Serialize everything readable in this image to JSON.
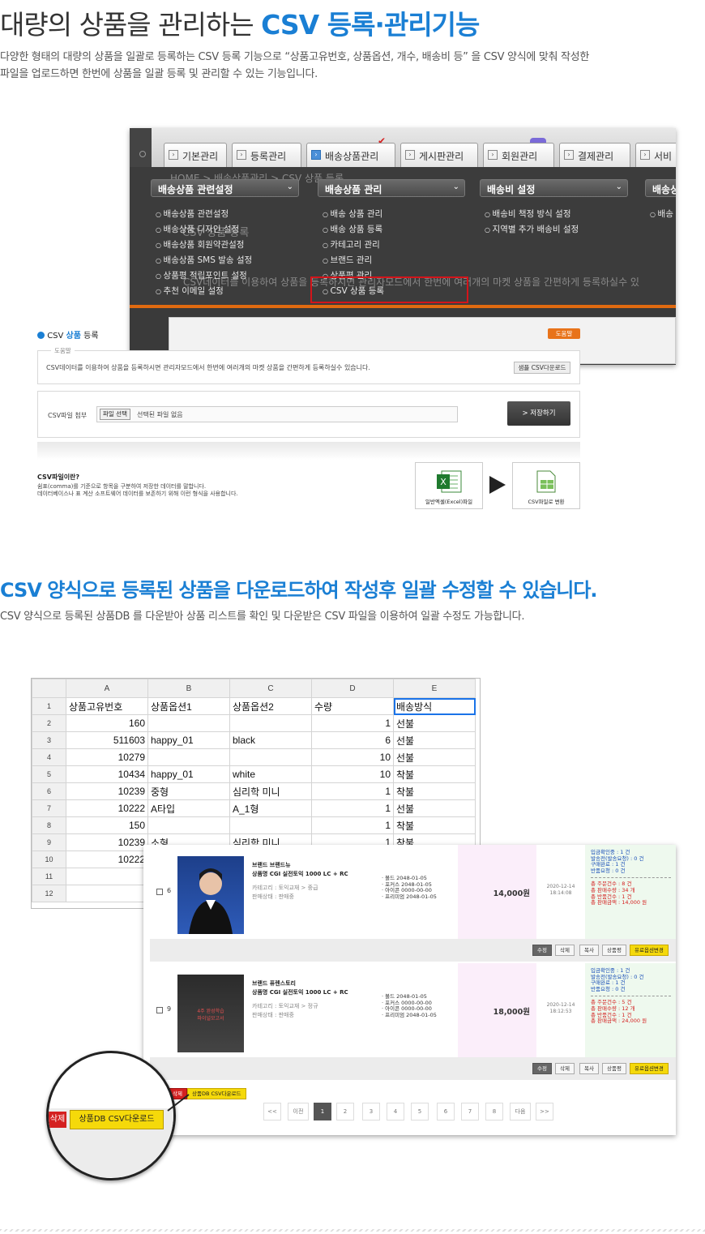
{
  "section1": {
    "title_plain": "대량의 상품을 관리하는 ",
    "title_highlight": "CSV 등록·관리기능",
    "desc_line1": "다양한 형태의 대량의 상품을 일괄로 등록하는 CSV 등록 기능으로 “상품고유번호, 상품옵션, 개수, 배송비 등” 을 CSV 양식에 맞춰 작성한",
    "desc_line2": "파일을 업로드하면 한번에 상품을 일괄 등록 및 관리할 수 있는 기능입니다."
  },
  "admin": {
    "tabs": [
      "기본관리",
      "등록관리",
      "배송상품관리",
      "게시판관리",
      "회원관리",
      "결제관리",
      "서비"
    ],
    "active_tab": "배송상품관리",
    "breadcrumb_ghost": "HOME > 배송상품관리 > CSV 상품 등록",
    "page_ghost": "CSV 상품 등록",
    "desc_ghost": "CSV데이터를 이용하여 상품을 등록하시면 관리자모드에서 한번에 여러개의 마켓 상품을 간편하게 등록하실수 있",
    "menus": [
      {
        "head": "배송상품 관련설정",
        "items": [
          "배송상품 관련설정",
          "배송상품 디자인 설정",
          "배송상품 회원약관설정",
          "배송상품 SMS 발송 설정",
          "상품평 적립포인트 설정",
          "추천 이메일 설정"
        ]
      },
      {
        "head": "배송상품 관리",
        "items": [
          "배송 상품 관리",
          "배송 상품 등록",
          "카테고리 관리",
          "브랜드 관리",
          "상품평 관리",
          "CSV 상품 등록"
        ]
      },
      {
        "head": "배송비 설정",
        "items": [
          "배송비 책정 방식 설정",
          "지역별 추가 배송비 설정"
        ]
      },
      {
        "head": "배송상",
        "items": [
          "배송"
        ]
      }
    ]
  },
  "csv_panel": {
    "title_prefix": "CSV ",
    "title_hl": "상품",
    "title_suffix": " 등록",
    "help": "도움말",
    "box_label": "도움말",
    "box_text": "CSV데이터를 이용하여 상품을 등록하시면 관리자모드에서 한번에 여러개의 마켓 상품을 간편하게 등록하실수 있습니다.",
    "sample_btn": "샘플 CSV다운로드",
    "file_label": "CSV파일 첨부",
    "file_btn": "파일 선택",
    "file_none": "선택된 파일 없음",
    "save_btn": "> 저장하기",
    "what_title": "CSV파일이란?",
    "what_line1": "쉼표(comma)를 기준으로 항목을 구분하여 저장한 데이터를 말합니다.",
    "what_line2": "데이터베이스나 표 계산 소프트웨어 데이터를 보존하기 위해 이런 형식을 사용합니다.",
    "icon1_cap": "일반엑셀(Excel)파일",
    "icon2_cap": "CSV파일로 변환"
  },
  "section2": {
    "title": "CSV 양식으로 등록된 상품을 다운로드하여 작성후 일괄 수정할 수 있습니다.",
    "desc": "CSV 양식으로 등록된 상품DB 를 다운받아 상품 리스트를 확인 및 다운받은 CSV 파일을 이용하여 일괄 수정도 가능합니다."
  },
  "sheet": {
    "cols": [
      "A",
      "B",
      "C",
      "D",
      "E"
    ],
    "rows": [
      [
        "1",
        "상품고유번호",
        "상품옵션1",
        "상품옵션2",
        "수량",
        "배송방식"
      ],
      [
        "2",
        "160",
        "",
        "",
        "1",
        "선불"
      ],
      [
        "3",
        "511603",
        "happy_01",
        "black",
        "6",
        "선불"
      ],
      [
        "4",
        "10279",
        "",
        "",
        "10",
        "선불"
      ],
      [
        "5",
        "10434",
        "happy_01",
        "white",
        "10",
        "착불"
      ],
      [
        "6",
        "10239",
        "중형",
        "심리학 미니",
        "1",
        "착불"
      ],
      [
        "7",
        "10222",
        "A타입",
        "A_1형",
        "1",
        "선불"
      ],
      [
        "8",
        "150",
        "",
        "",
        "1",
        "착불"
      ],
      [
        "9",
        "10239",
        "소형",
        "심리학 미니",
        "1",
        "착불"
      ],
      [
        "10",
        "10222",
        "",
        "",
        "",
        ""
      ],
      [
        "11",
        "",
        "",
        "",
        "",
        ""
      ],
      [
        "12",
        "",
        "",
        "",
        "",
        ""
      ]
    ]
  },
  "products": [
    {
      "no": "6",
      "brand": "브랜드 브랜드뉴",
      "name": "상품명 CGI 실전토익 1000 LC + RC",
      "cat": "카테고리 : 토익교재 > 중급",
      "state": "판매상태 : 판매중",
      "opts": [
        "· 볼드 2048-01-05",
        "· 포커스 2048-01-05",
        "· 아이콘 0000-00-00",
        "· 프리미엄 2048-01-05"
      ],
      "price": "14,000원",
      "date": "2020-12-14",
      "time": "18:14:08",
      "stat_blue": [
        "입금확인중 : 1 건",
        "발송전(발송요청) : 0 건",
        "구매완료 : 1 건",
        "반품요청 : 0 건"
      ],
      "stat_red": [
        "총 주문건수 : 8 건",
        "총 판매수량 : 34 개",
        "총 반품건수 : 1 건",
        "총 판매금액 : 14,000 원"
      ]
    },
    {
      "no": "9",
      "brand": "브랜드 퓨렌스토리",
      "name": "상품명 CGI 실전토익 1000 LC + RC",
      "cat": "카테고리 : 토익교재 > 정규",
      "state": "판매상태 : 판매중",
      "opts": [
        "· 볼드 2048-01-05",
        "· 포커스 0000-00-00",
        "· 아이콘 0000-00-00",
        "· 프리미엄 2048-01-05"
      ],
      "price": "18,000원",
      "date": "2020-12-14",
      "time": "18:12:53",
      "stat_blue": [
        "입금확인중 : 1 건",
        "발송전(발송요청) : 0 건",
        "구매완료 : 1 건",
        "반품요청 : 0 건"
      ],
      "stat_red": [
        "총 주문건수 : 5 건",
        "총 판매수량 : 12 개",
        "총 반품건수 : 1 건",
        "총 판매금액 : 24,000 원"
      ]
    }
  ],
  "row_buttons": [
    "수정",
    "삭제",
    "복사",
    "상품평",
    "유료옵션변경"
  ],
  "list_buttons": {
    "delete": "삭제",
    "csv": "상품DB CSV다운로드"
  },
  "pager": [
    "<<",
    "이전",
    "1",
    "2",
    "3",
    "4",
    "5",
    "6",
    "7",
    "8",
    "다음",
    ">>"
  ],
  "book_cover_text": "4주 완성학습\n파이널모고서",
  "colors": {
    "accent": "#1a7fd4",
    "red": "#d42020",
    "yellow": "#f5d90a",
    "orange": "#e8731a"
  }
}
